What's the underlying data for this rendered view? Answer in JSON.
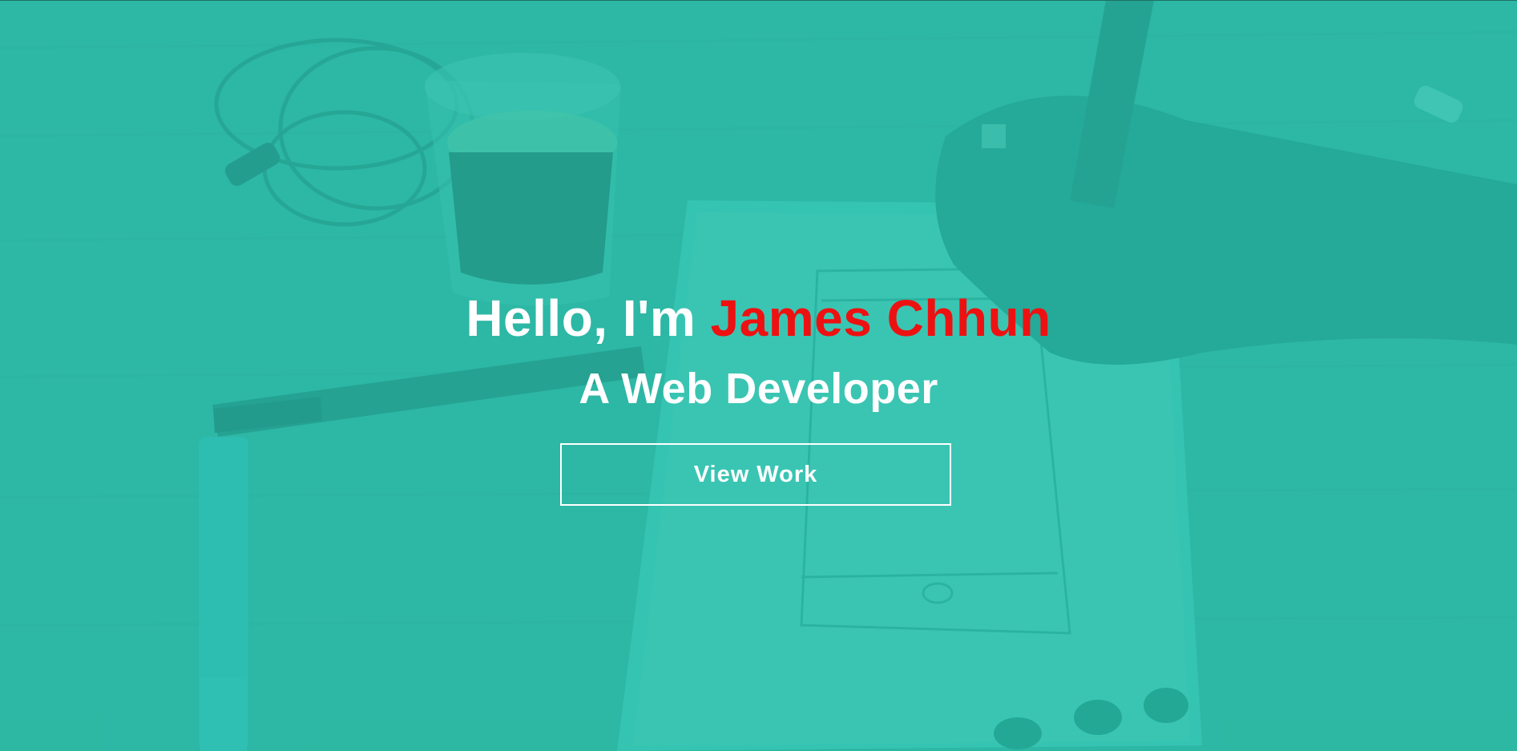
{
  "hero": {
    "greeting": "Hello, I'm ",
    "name": "James Chhun",
    "tagline": "A Web Developer",
    "cta_label": "View Work"
  },
  "colors": {
    "overlay": "#28beaa",
    "name_accent": "#ee1111",
    "text": "#ffffff"
  }
}
